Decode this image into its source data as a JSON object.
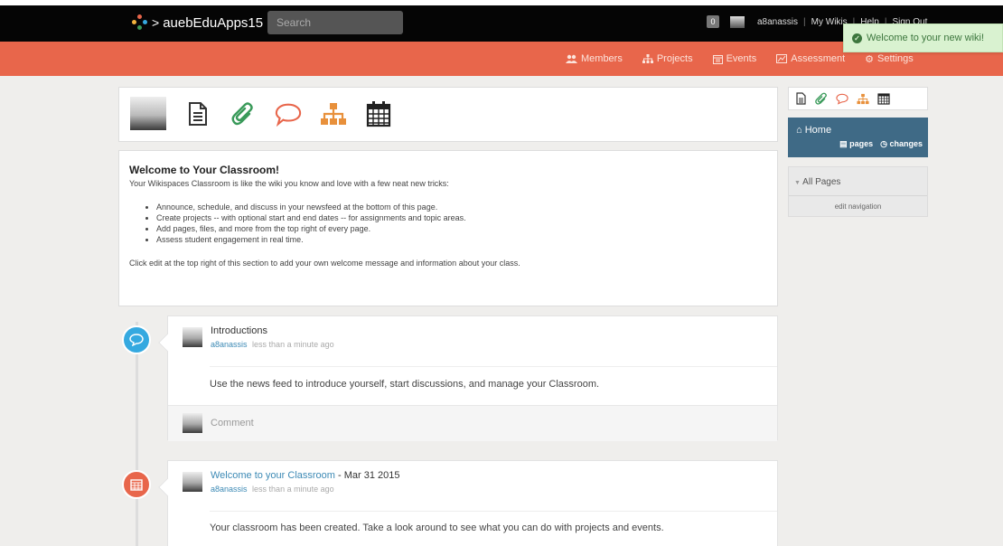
{
  "topbar": {
    "site_name": "auebEduApps15",
    "search_placeholder": "Search",
    "notification_count": "0",
    "username": "a8anassis",
    "links": [
      "My Wikis",
      "Help",
      "Sign Out"
    ]
  },
  "toast": {
    "message": "Welcome to your new wiki!"
  },
  "nav": {
    "items": [
      {
        "label": "Members",
        "icon": "members-icon"
      },
      {
        "label": "Projects",
        "icon": "projects-icon"
      },
      {
        "label": "Events",
        "icon": "calendar-icon"
      },
      {
        "label": "Assessment",
        "icon": "assessment-icon"
      },
      {
        "label": "Settings",
        "icon": "gear-icon"
      }
    ]
  },
  "welcome": {
    "title": "Welcome to Your Classroom!",
    "intro": "Your Wikispaces Classroom is like the wiki you know and love with a few neat new tricks:",
    "bullets": [
      "Announce, schedule, and discuss in your newsfeed at the bottom of this page.",
      "Create projects -- with optional start and end dates -- for assignments and topic areas.",
      "Add pages, files, and more from the top right of every page.",
      "Assess student engagement in real time."
    ],
    "outro": "Click edit at the top right of this section to add your own welcome message and information about your class."
  },
  "feed": [
    {
      "title": "Introductions",
      "author": "a8anassis",
      "time": "less than a minute ago",
      "body": "Use the news feed to introduce yourself, start discussions, and manage your Classroom.",
      "comment_placeholder": "Comment"
    },
    {
      "title_link": "Welcome to your Classroom",
      "title_suffix": " - Mar 31 2015",
      "author": "a8anassis",
      "time": "less than a minute ago",
      "body": "Your classroom has been created. Take a look around to see what you can do with projects and events."
    }
  ],
  "sidebar": {
    "home": "Home",
    "pages_link": "pages",
    "changes_link": "changes",
    "all_pages": "All Pages",
    "edit_navigation": "edit navigation"
  },
  "colors": {
    "orange": "#e8664b",
    "green": "#3a9a5a",
    "blue": "#35a9e0",
    "home_bg": "#3f6a86"
  }
}
